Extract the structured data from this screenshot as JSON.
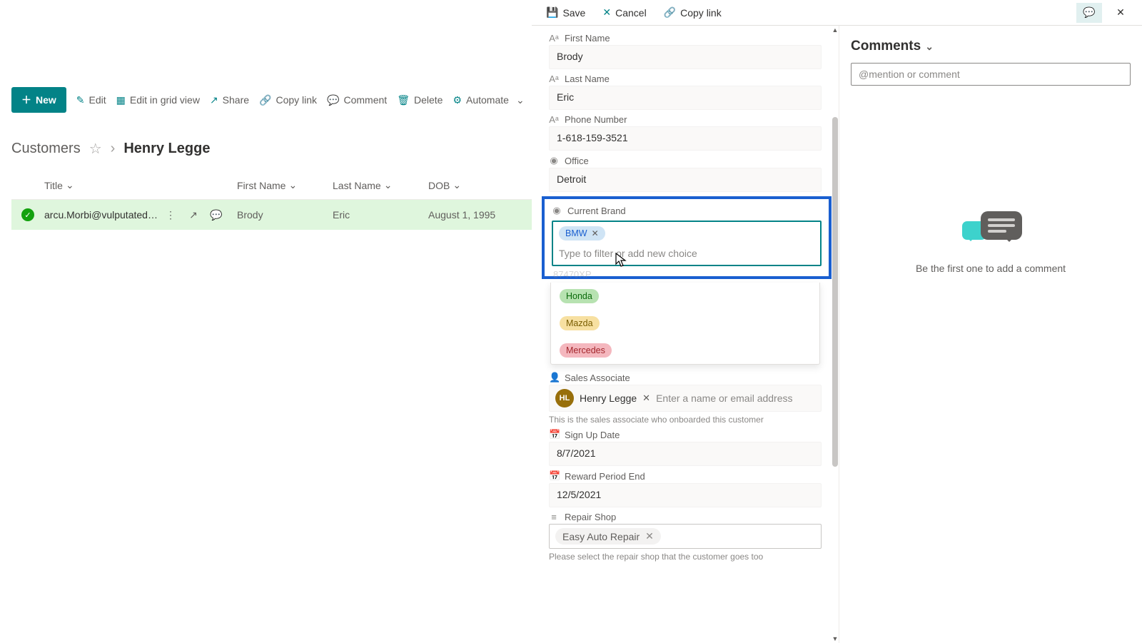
{
  "header": {
    "save": "Save",
    "cancel": "Cancel",
    "copylink": "Copy link"
  },
  "toolbar": {
    "new": "New",
    "edit": "Edit",
    "grid": "Edit in grid view",
    "share": "Share",
    "copylink": "Copy link",
    "comment": "Comment",
    "delete": "Delete",
    "automate": "Automate"
  },
  "breadcrumb": {
    "root": "Customers",
    "current": "Henry Legge"
  },
  "columns": {
    "title": "Title",
    "first": "First Name",
    "last": "Last Name",
    "dob": "DOB"
  },
  "row": {
    "title": "arcu.Morbi@vulputatedu...",
    "first": "Brody",
    "last": "Eric",
    "dob": "August 1, 1995"
  },
  "form": {
    "first_label": "First Name",
    "first_val": "Brody",
    "last_label": "Last Name",
    "last_val": "Eric",
    "phone_label": "Phone Number",
    "phone_val": "1-618-159-3521",
    "office_label": "Office",
    "office_val": "Detroit",
    "brand_label": "Current Brand",
    "brand_chip": "BMW",
    "brand_placeholder": "Type to filter or add new choice",
    "plate_partial": "87470XP",
    "brand_options": {
      "honda": "Honda",
      "mazda": "Mazda",
      "mercedes": "Mercedes"
    },
    "sa_label": "Sales Associate",
    "sa_initials": "HL",
    "sa_name": "Henry Legge",
    "sa_placeholder": "Enter a name or email address",
    "sa_help": "This is the sales associate who onboarded this customer",
    "signup_label": "Sign Up Date",
    "signup_val": "8/7/2021",
    "reward_label": "Reward Period End",
    "reward_val": "12/5/2021",
    "repair_label": "Repair Shop",
    "repair_chip": "Easy Auto Repair",
    "repair_help": "Please select the repair shop that the customer goes too"
  },
  "comments": {
    "title": "Comments",
    "placeholder": "@mention or comment",
    "empty": "Be the first one to add a comment"
  }
}
